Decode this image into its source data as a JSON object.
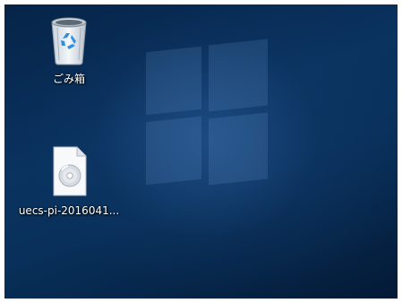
{
  "desktop": {
    "icons": [
      {
        "label": "ごみ箱",
        "icon": "recycle-bin-icon"
      },
      {
        "label": "uecs-pi-2016041...",
        "icon": "disc-image-file-icon"
      }
    ]
  },
  "colors": {
    "wallpaper_dark": "#041a36",
    "wallpaper_mid": "#0a3360",
    "wallpaper_light": "#285a96",
    "label_text": "#ffffff",
    "recycle_symbol": "#2f8fe0"
  }
}
